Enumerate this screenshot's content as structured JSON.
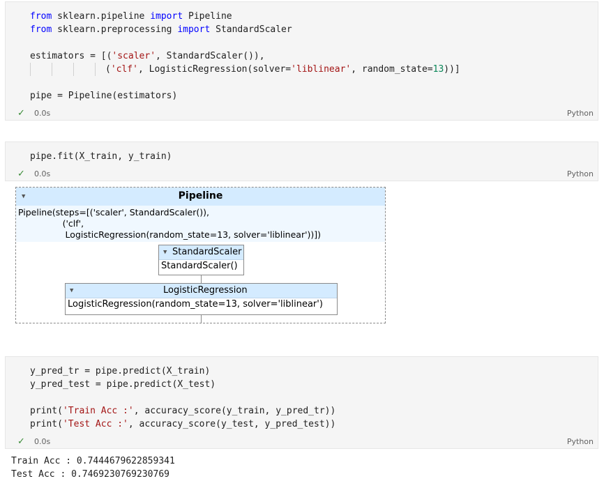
{
  "cells": [
    {
      "time": "0.0s",
      "language": "Python",
      "lines": {
        "l1": {
          "k1": "from",
          "t1": " sklearn.pipeline ",
          "k2": "import",
          "t2": " Pipeline"
        },
        "l2": {
          "k1": "from",
          "t1": " sklearn.preprocessing ",
          "k2": "import",
          "t2": " StandardScaler"
        },
        "l4": {
          "t1": "estimators = [(",
          "s1": "'scaler'",
          "t2": ", StandardScaler()),",
          "pad": ""
        },
        "l5": {
          "t1": "(",
          "s1": "'clf'",
          "t2": ", LogisticRegression(solver=",
          "s2": "'liblinear'",
          "t3": ", random_state=",
          "n1": "13",
          "t4": "))]"
        },
        "l7": {
          "t1": "pipe = Pipeline(estimators)"
        }
      }
    },
    {
      "time": "0.0s",
      "language": "Python",
      "lines": {
        "l1": {
          "t1": "pipe.fit(X_train, y_train)"
        }
      }
    },
    {
      "time": "0.0s",
      "language": "Python",
      "lines": {
        "l1": {
          "t1": "y_pred_tr = pipe.predict(X_train)"
        },
        "l2": {
          "t1": "y_pred_test = pipe.predict(X_test)"
        },
        "l4": {
          "t1": "print(",
          "s1": "'Train Acc :'",
          "t2": ", accuracy_score(y_train, y_pred_tr))"
        },
        "l5": {
          "t1": "print(",
          "s1": "'Test Acc :'",
          "t2": ", accuracy_score(y_test, y_pred_test))"
        }
      }
    }
  ],
  "pipeline_diagram": {
    "title": "Pipeline",
    "repr_line1": "Pipeline(steps=[('scaler', StandardScaler()),",
    "repr_line2": "                ('clf',",
    "repr_line3": "                 LogisticRegression(random_state=13, solver='liblinear'))])",
    "scaler": {
      "title": "StandardScaler",
      "body": "StandardScaler()"
    },
    "clf": {
      "title": "LogisticRegression",
      "body": "LogisticRegression(random_state=13, solver='liblinear')"
    },
    "toggle_icon": "triangle-down-icon"
  },
  "outputs": {
    "train": "Train Acc : 0.7444679622859341",
    "test": "Test Acc : 0.7469230769230769"
  },
  "colors": {
    "keyword": "#0000ff",
    "string": "#a31515",
    "number": "#098658",
    "check": "#388a34",
    "estimator_header": "#d4ebff"
  }
}
